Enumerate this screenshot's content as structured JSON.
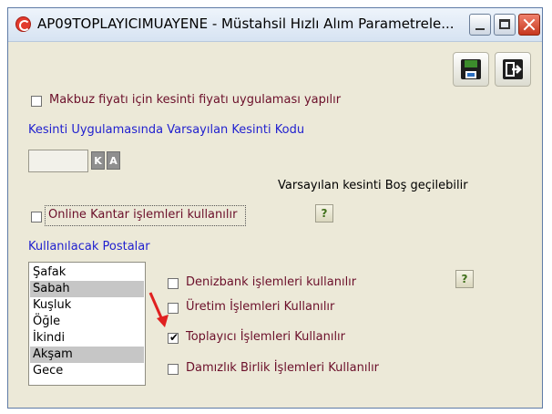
{
  "window": {
    "title": "AP09TOPLAYICIMUAYENE - Müstahsil Hızlı Alım Parametrele..."
  },
  "toolbar": {
    "save_icon": "floppy-disk-icon",
    "exit_icon": "exit-door-icon"
  },
  "settings": {
    "makbuz_label": "Makbuz fiyatı için kesinti fiyatı uygulaması yapılır",
    "makbuz_checked": false,
    "kesinti_section_label": "Kesinti Uygulamasında Varsayılan Kesinti Kodu",
    "kesinti_code_value": "",
    "kesinti_k_label": "K",
    "kesinti_a_label": "A",
    "varsayilan_bos_label": "Varsayılan kesinti Boş geçilebilir",
    "online_kantar_label": "Online Kantar işlemleri kullanılır",
    "online_kantar_checked": false,
    "help_label": "?"
  },
  "postalar": {
    "label": "Kullanılacak Postalar",
    "items": [
      {
        "label": "Şafak",
        "selected": false
      },
      {
        "label": "Sabah",
        "selected": true
      },
      {
        "label": "Kuşluk",
        "selected": false
      },
      {
        "label": "Öğle",
        "selected": false
      },
      {
        "label": "İkindi",
        "selected": false
      },
      {
        "label": "Akşam",
        "selected": true
      },
      {
        "label": "Gece",
        "selected": false
      }
    ]
  },
  "options": {
    "denizbank_label": "Denizbank işlemleri kullanılır",
    "denizbank_checked": false,
    "uretim_label": "Üretim İşlemleri Kullanılır",
    "uretim_checked": false,
    "toplayici_label": "Toplayıcı İşlemleri Kullanılır",
    "toplayici_checked": true,
    "damizlik_label": "Damızlık Birlik İşlemleri Kullanılır",
    "damizlik_checked": false,
    "help_label": "?"
  },
  "colors": {
    "window_bg": "#ece9d8",
    "label_dark_red": "#6b0f2a",
    "label_blue": "#1f1fcf",
    "arrow_red": "#e02020"
  }
}
